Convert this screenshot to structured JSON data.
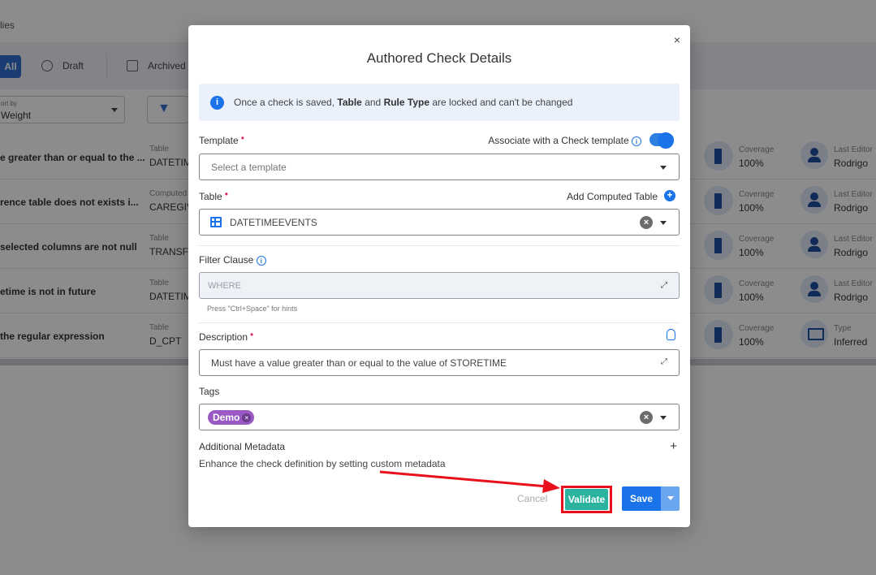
{
  "background": {
    "breadcrumb": "lies",
    "tabs": {
      "all": "All",
      "draft": "Draft",
      "archived": "Archived"
    },
    "sort": {
      "label": "ort by",
      "value": "Weight"
    },
    "rows": [
      {
        "name": "e greater than or equal to the ...",
        "table_label": "Table",
        "table_value": "DATETIM",
        "coverage_label": "Coverage",
        "coverage_value": "100%",
        "editor_label": "Last Editor",
        "editor_value": "Rodrigo"
      },
      {
        "name": "rence table does not exists i...",
        "table_label": "Computed",
        "table_value": "CAREGIV",
        "coverage_label": "Coverage",
        "coverage_value": "100%",
        "editor_label": "Last Editor",
        "editor_value": "Rodrigo"
      },
      {
        "name": "selected columns are not null",
        "table_label": "Table",
        "table_value": "TRANSFE",
        "coverage_label": "Coverage",
        "coverage_value": "100%",
        "editor_label": "Last Editor",
        "editor_value": "Rodrigo"
      },
      {
        "name": "etime is not in future",
        "table_label": "Table",
        "table_value": "DATETIM",
        "coverage_label": "Coverage",
        "coverage_value": "100%",
        "editor_label": "Last Editor",
        "editor_value": "Rodrigo"
      },
      {
        "name": "the regular expression",
        "table_label": "Table",
        "table_value": "D_CPT",
        "coverage_label": "Coverage",
        "coverage_value": "100%",
        "editor_label": "Type",
        "editor_value": "Inferred"
      }
    ]
  },
  "modal": {
    "title": "Authored Check Details",
    "close": "×",
    "info": {
      "pre": "Once a check is saved, ",
      "b1": "Table",
      "mid": " and ",
      "b2": "Rule Type",
      "post": " are locked and can't be changed"
    },
    "template": {
      "label": "Template",
      "required": "•",
      "associate_label": "Associate with a Check template",
      "placeholder": "Select a template"
    },
    "table": {
      "label": "Table",
      "required": "•",
      "add_computed": "Add Computed Table",
      "value": "DATETIMEEVENTS"
    },
    "filter": {
      "label": "Filter Clause",
      "placeholder": "WHERE",
      "hint": "Press \"Ctrl+Space\" for hints"
    },
    "description": {
      "label": "Description",
      "required": "•",
      "value": "Must have a value greater than or equal to the value of STORETIME"
    },
    "tags": {
      "label": "Tags",
      "chip": "Demo"
    },
    "metadata": {
      "label": "Additional Metadata",
      "subtitle": "Enhance the check definition by setting custom metadata",
      "plus": "+"
    },
    "buttons": {
      "cancel": "Cancel",
      "validate": "Validate",
      "save": "Save"
    }
  },
  "colors": {
    "primary": "#1a73e8",
    "validate": "#2bb3a0",
    "highlight": "#e8101a",
    "tag": "#9b59c4",
    "required": "#d6246e"
  }
}
